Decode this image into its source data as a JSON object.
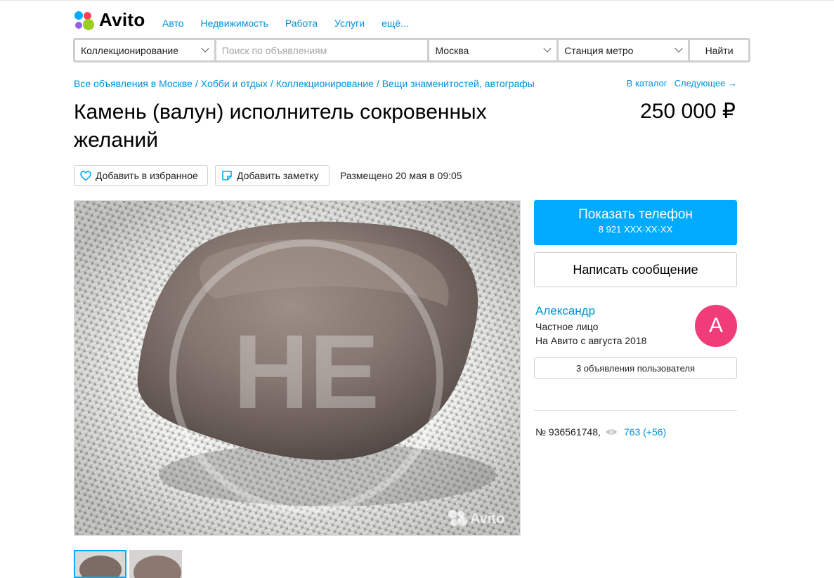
{
  "header": {
    "logo_text": "Avito",
    "nav": [
      "Авто",
      "Недвижимость",
      "Работа",
      "Услуги",
      "ещё..."
    ]
  },
  "search": {
    "category": "Коллекционирование",
    "placeholder": "Поиск по объявлениям",
    "city": "Москва",
    "metro": "Станция метро",
    "submit": "Найти"
  },
  "breadcrumbs": [
    "Все объявления в Москве",
    "Хобби и отдых",
    "Коллекционирование",
    "Вещи знаменитостей, автографы"
  ],
  "catalog_link": "В каталог",
  "next_link": "Следующее →",
  "listing": {
    "title": "Камень (валун) исполнитель сокровенных желаний",
    "price": "250 000 ₽",
    "favorite_label": "Добавить в избранное",
    "note_label": "Добавить заметку",
    "posted": "Размещено 20 мая в 09:05",
    "watermark": "Avito",
    "id": "№ 936561748,",
    "views": "763 (+56)"
  },
  "contact": {
    "phone_button": "Показать телефон",
    "phone_masked": "8 921 XXX-XX-XX",
    "message_button": "Написать сообщение"
  },
  "seller": {
    "name": "Александр",
    "type": "Частное лицо",
    "since": "На Авито с августа 2018",
    "avatar_letter": "А",
    "ads_button": "3 объявления пользователя"
  },
  "colors": {
    "accent": "#00aaff",
    "link": "#0091d9",
    "avatar": "#f03c78"
  }
}
